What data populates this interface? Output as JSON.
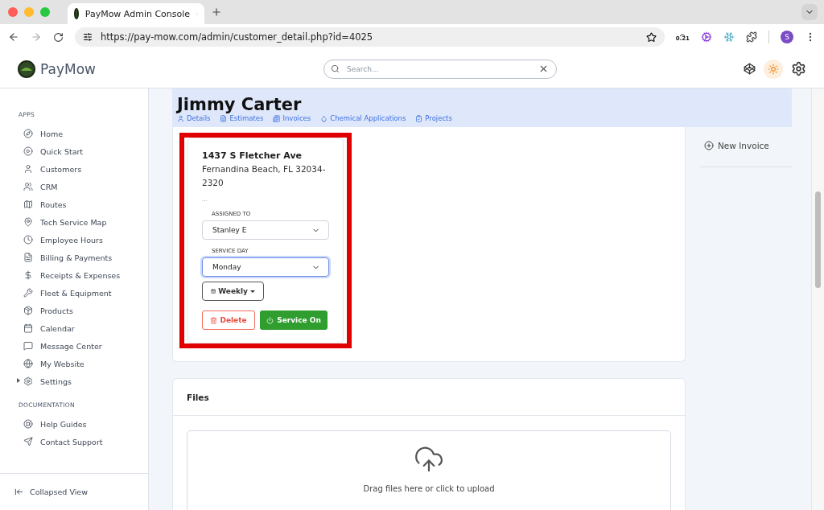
{
  "browser": {
    "tab_title": "PayMow Admin Console",
    "url": "https://pay-mow.com/admin/customer_detail.php?id=4025",
    "extension_badge": "0.21",
    "profile_initial": "S"
  },
  "app": {
    "logo_text": "PayMow",
    "search": {
      "placeholder": "Search..."
    }
  },
  "sidebar": {
    "sections": [
      {
        "title": "APPS",
        "items": [
          {
            "label": "Home",
            "kind": "link"
          },
          {
            "label": "Quick Start",
            "kind": "link"
          },
          {
            "label": "Customers",
            "kind": "link"
          },
          {
            "label": "CRM",
            "kind": "link"
          },
          {
            "label": "Routes",
            "kind": "link"
          },
          {
            "label": "Tech Service Map",
            "kind": "link"
          },
          {
            "label": "Employee Hours",
            "kind": "link"
          },
          {
            "label": "Billing & Payments",
            "kind": "link"
          },
          {
            "label": "Receipts & Expenses",
            "kind": "link"
          },
          {
            "label": "Fleet & Equipment",
            "kind": "link"
          },
          {
            "label": "Products",
            "kind": "link"
          },
          {
            "label": "Calendar",
            "kind": "link"
          },
          {
            "label": "Message Center",
            "kind": "link"
          },
          {
            "label": "My Website",
            "kind": "link"
          },
          {
            "label": "Settings",
            "kind": "group"
          }
        ]
      },
      {
        "title": "DOCUMENTATION",
        "items": [
          {
            "label": "Help Guides",
            "kind": "link"
          },
          {
            "label": "Contact Support",
            "kind": "link"
          }
        ]
      }
    ],
    "footer": "Collapsed View"
  },
  "customer": {
    "name": "Jimmy Carter",
    "tabs": [
      "Details",
      "Estimates",
      "Invoices",
      "Chemical Applications",
      "Projects"
    ]
  },
  "service_card": {
    "address_line1": "1437 S Fletcher Ave",
    "address_line2": "Fernandina Beach, FL 32034-2320",
    "notes": "...",
    "fields": [
      {
        "label": "ASSIGNED TO",
        "value": "Stanley E",
        "focused": false
      },
      {
        "label": "SERVICE DAY",
        "value": "Monday",
        "focused": true
      }
    ],
    "frequency": "Weekly",
    "delete_button": "Delete",
    "service_button": "Service On"
  },
  "actions": [
    "New Invoice"
  ],
  "files": {
    "title": "Files",
    "dropzone_text": "Drag files here or click to upload"
  }
}
